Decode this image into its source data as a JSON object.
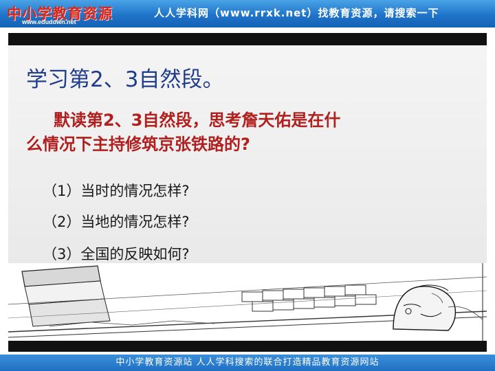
{
  "header": {
    "logo_text": "中小学教育资源",
    "logo_url": "www.edudown.net",
    "slogan": "人人学科网（www.rrxk.net）找教育资源，请搜索一下"
  },
  "slide": {
    "title": "学习第2、3自然段。",
    "question_line1": "默读第2、3自然段，思考詹天佑是在什",
    "question_line2": "么情况下主持修筑京张铁路的?",
    "sub_questions": [
      "（1）当时的情况怎样?",
      "（2）当地的情况怎样?",
      "（3）全国的反映如何?"
    ]
  },
  "footer": {
    "text": "中小学教育资源站  人人学科搜索的联合打造精品教育资源网站"
  },
  "colors": {
    "header_blue": "#1f74c9",
    "title_blue": "#1f3b8c",
    "question_red": "#b01e1e",
    "slide_border": "#111111"
  }
}
